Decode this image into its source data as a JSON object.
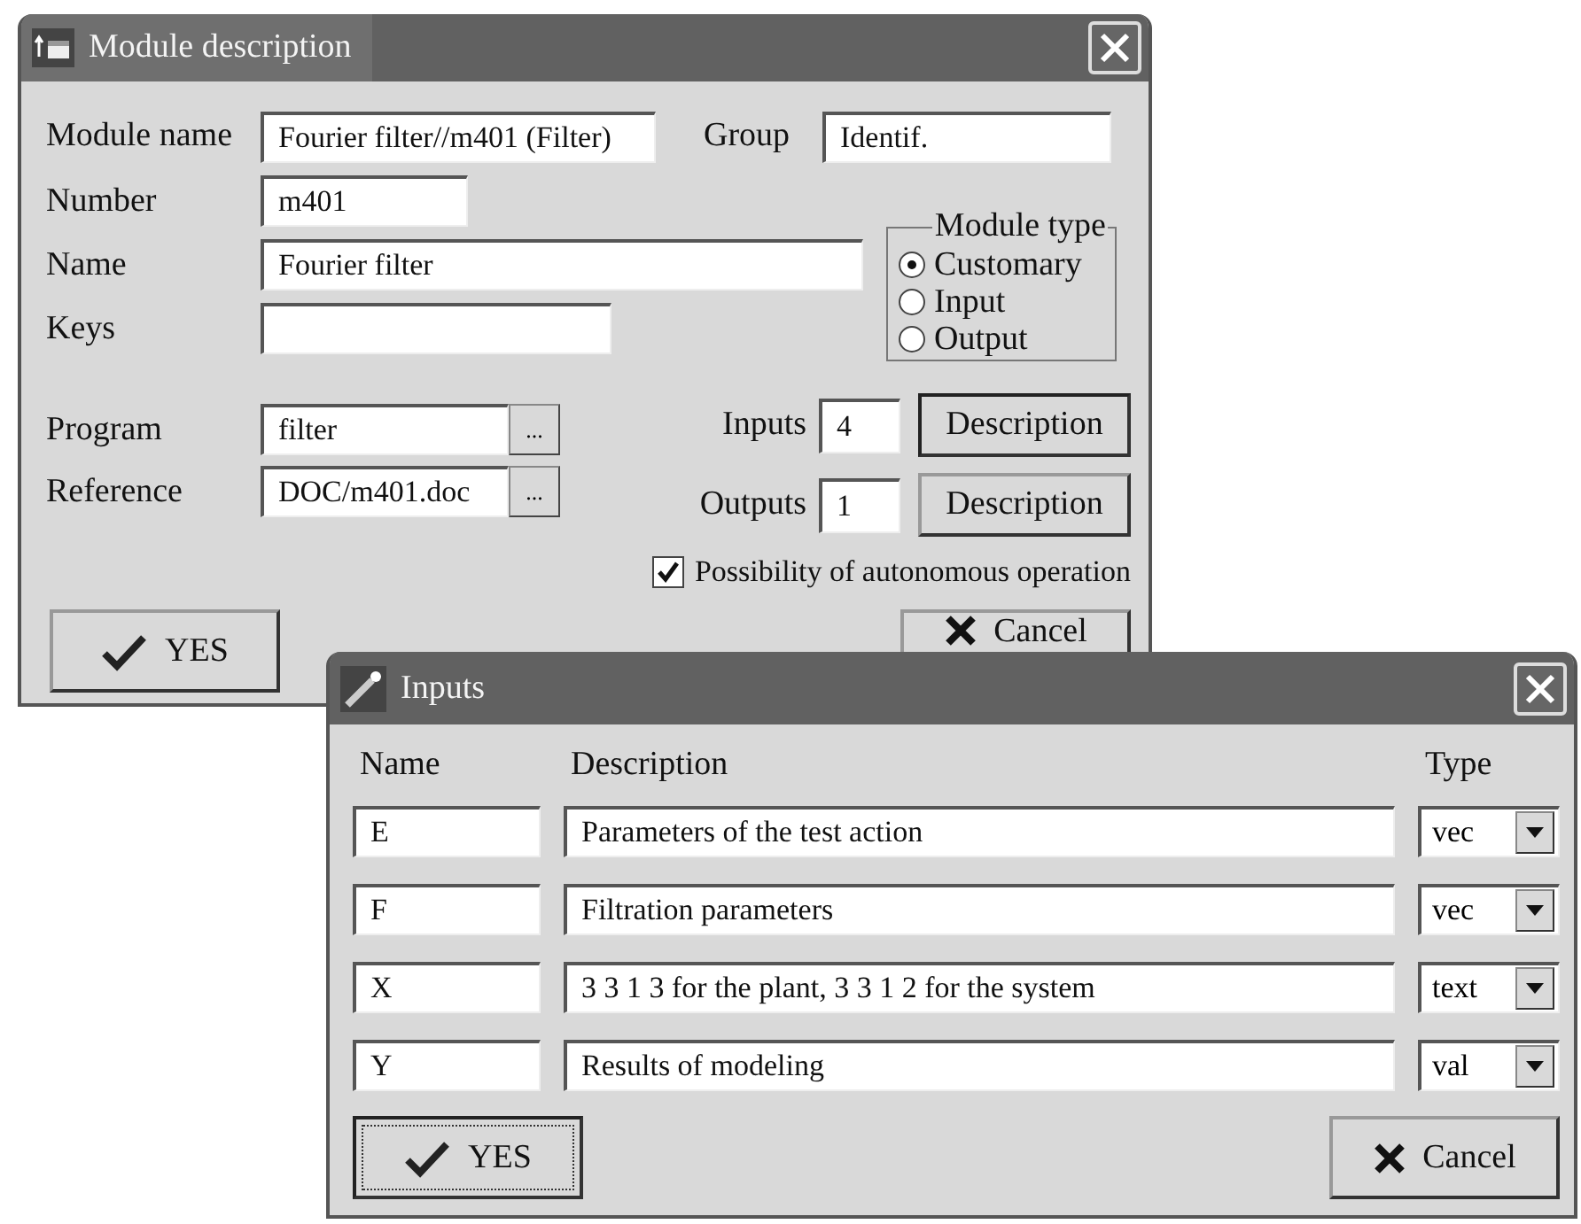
{
  "module_dialog": {
    "title": "Module description",
    "module_name": {
      "label": "Module name",
      "value": "Fourier filter//m401 (Filter)"
    },
    "group": {
      "label": "Group",
      "value": "Identif."
    },
    "number": {
      "label": "Number",
      "value": "m401"
    },
    "name": {
      "label": "Name",
      "value": "Fourier filter"
    },
    "keys": {
      "label": "Keys"
    },
    "module_type": {
      "title": "Module type",
      "options": [
        {
          "label": "Customary",
          "selected": true
        },
        {
          "label": "Input",
          "selected": false
        },
        {
          "label": "Output",
          "selected": false
        }
      ]
    },
    "program": {
      "label": "Program",
      "value": "filter",
      "browse": "..."
    },
    "reference": {
      "label": "Reference",
      "value": "DOC/m401.doc",
      "browse": "..."
    },
    "inputs": {
      "label": "Inputs",
      "value": "4",
      "button": "Description"
    },
    "outputs": {
      "label": "Outputs",
      "value": "1",
      "button": "Description"
    },
    "autonomous": {
      "label": "Possibility of autonomous operation",
      "checked": true
    },
    "yes_button": "YES",
    "cancel_button": "Cancel"
  },
  "inputs_dialog": {
    "title": "Inputs",
    "columns": [
      "Name",
      "Description",
      "Type"
    ],
    "rows": [
      {
        "name": "E",
        "description": "Parameters of the test action",
        "type": "vec"
      },
      {
        "name": "F",
        "description": "Filtration parameters",
        "type": "vec"
      },
      {
        "name": "X",
        "description": "3 3 1 3 for the plant, 3 3 1 2 for the system",
        "type": "text"
      },
      {
        "name": "Y",
        "description": "Results of modeling",
        "type": "val"
      }
    ],
    "yes_button": "YES",
    "cancel_button": "Cancel"
  }
}
